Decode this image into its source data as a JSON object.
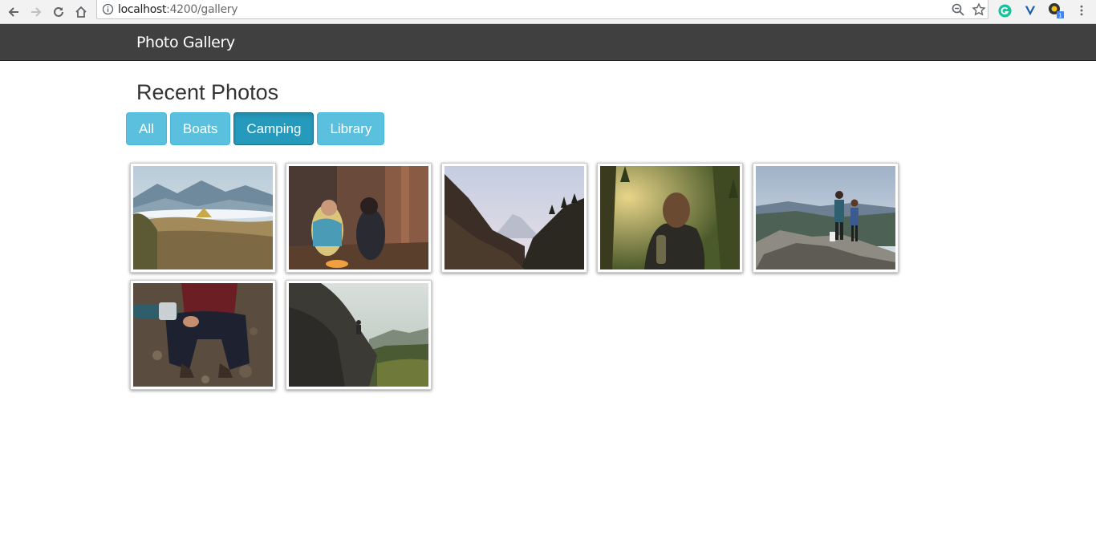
{
  "browser": {
    "url_host": "localhost",
    "url_path": ":4200/gallery"
  },
  "navbar": {
    "brand": "Photo Gallery"
  },
  "page": {
    "heading": "Recent Photos"
  },
  "filters": [
    {
      "label": "All",
      "active": false
    },
    {
      "label": "Boats",
      "active": false
    },
    {
      "label": "Camping",
      "active": true
    },
    {
      "label": "Library",
      "active": false
    }
  ],
  "photos": [
    {
      "name": "tent-in-mountains"
    },
    {
      "name": "two-women-at-campfire"
    },
    {
      "name": "mountain-valley"
    },
    {
      "name": "hiker-in-forest"
    },
    {
      "name": "couple-on-cliff"
    },
    {
      "name": "person-with-thermos"
    },
    {
      "name": "climber-on-rock"
    }
  ]
}
